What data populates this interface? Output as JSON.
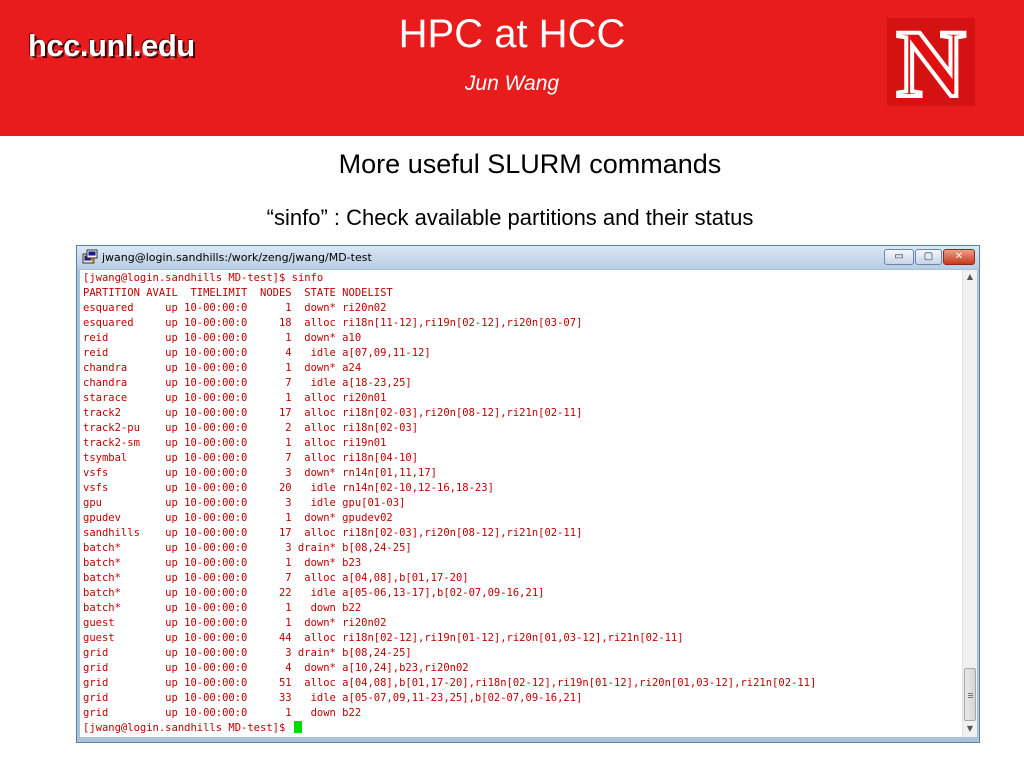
{
  "header": {
    "brand": "hcc.unl.edu",
    "title": "HPC at HCC",
    "author": "Jun Wang",
    "logo_letter": "N",
    "colors": {
      "banner": "#e81c1c",
      "logo_fill": "#cc0000"
    }
  },
  "subheading": "More useful SLURM commands",
  "caption": "“sinfo” : Check available partitions and their status",
  "window": {
    "title": "jwang@login.sandhills:/work/zeng/jwang/MD-test",
    "app_icon": "putty-terminal-icon",
    "buttons": {
      "minimize": "▭",
      "maximize": "▢",
      "close": "✕"
    }
  },
  "terminal": {
    "text_color": "#c00000",
    "cursor_color": "#00d800",
    "prompt": "[jwang@login.sandhills MD-test]$ ",
    "command": "sinfo",
    "header": "PARTITION AVAIL  TIMELIMIT  NODES  STATE NODELIST",
    "rows": [
      "esquared     up 10-00:00:0      1  down* ri20n02",
      "esquared     up 10-00:00:0     18  alloc ri18n[11-12],ri19n[02-12],ri20n[03-07]",
      "reid         up 10-00:00:0      1  down* a10",
      "reid         up 10-00:00:0      4   idle a[07,09,11-12]",
      "chandra      up 10-00:00:0      1  down* a24",
      "chandra      up 10-00:00:0      7   idle a[18-23,25]",
      "starace      up 10-00:00:0      1  alloc ri20n01",
      "track2       up 10-00:00:0     17  alloc ri18n[02-03],ri20n[08-12],ri21n[02-11]",
      "track2-pu    up 10-00:00:0      2  alloc ri18n[02-03]",
      "track2-sm    up 10-00:00:0      1  alloc ri19n01",
      "tsymbal      up 10-00:00:0      7  alloc ri18n[04-10]",
      "vsfs         up 10-00:00:0      3  down* rn14n[01,11,17]",
      "vsfs         up 10-00:00:0     20   idle rn14n[02-10,12-16,18-23]",
      "gpu          up 10-00:00:0      3   idle gpu[01-03]",
      "gpudev       up 10-00:00:0      1  down* gpudev02",
      "sandhills    up 10-00:00:0     17  alloc ri18n[02-03],ri20n[08-12],ri21n[02-11]",
      "batch*       up 10-00:00:0      3 drain* b[08,24-25]",
      "batch*       up 10-00:00:0      1  down* b23",
      "batch*       up 10-00:00:0      7  alloc a[04,08],b[01,17-20]",
      "batch*       up 10-00:00:0     22   idle a[05-06,13-17],b[02-07,09-16,21]",
      "batch*       up 10-00:00:0      1   down b22",
      "guest        up 10-00:00:0      1  down* ri20n02",
      "guest        up 10-00:00:0     44  alloc ri18n[02-12],ri19n[01-12],ri20n[01,03-12],ri21n[02-11]",
      "grid         up 10-00:00:0      3 drain* b[08,24-25]",
      "grid         up 10-00:00:0      4  down* a[10,24],b23,ri20n02",
      "grid         up 10-00:00:0     51  alloc a[04,08],b[01,17-20],ri18n[02-12],ri19n[01-12],ri20n[01,03-12],ri21n[02-11]",
      "grid         up 10-00:00:0     33   idle a[05-07,09,11-23,25],b[02-07,09-16,21]",
      "grid         up 10-00:00:0      1   down b22"
    ]
  },
  "scrollbar": {
    "up_icon": "scroll-up-arrow-icon",
    "down_icon": "scroll-down-arrow-icon",
    "up_glyph": "▲",
    "down_glyph": "▼",
    "position_fraction": 1.0
  }
}
